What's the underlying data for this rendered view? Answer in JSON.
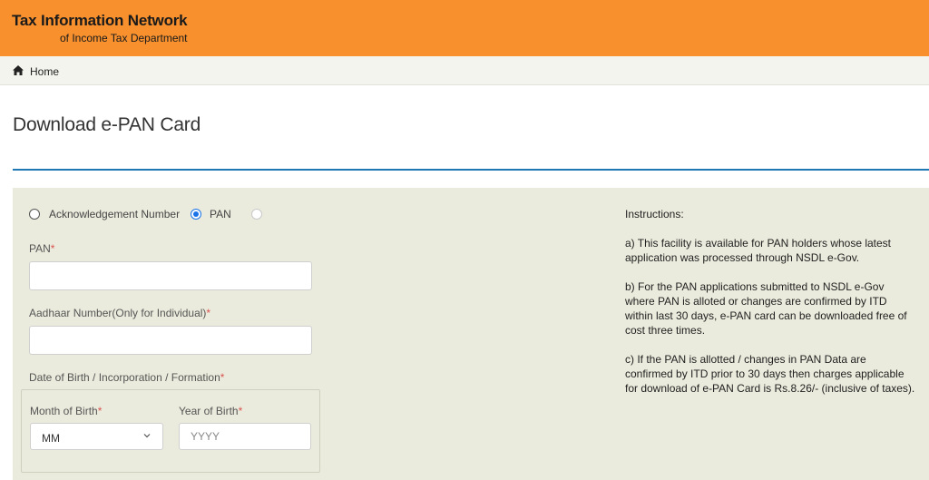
{
  "header": {
    "title": "Tax Information Network",
    "subtitle": "of Income Tax Department",
    "background_color": "#f7902d"
  },
  "breadcrumb": {
    "home_label": "Home",
    "home_icon": "home-icon"
  },
  "page": {
    "title": "Download e-PAN Card",
    "rule_color": "#1f78b4"
  },
  "form": {
    "radio_options": [
      {
        "label": "Acknowledgement Number",
        "checked": false
      },
      {
        "label": "PAN",
        "checked": true
      },
      {
        "label": "",
        "checked": false
      }
    ],
    "pan_label": "PAN",
    "pan_value": "",
    "aadhaar_label": "Aadhaar Number(Only for Individual)",
    "aadhaar_value": "",
    "dob_label": "Date of Birth / Incorporation / Formation",
    "month_label": "Month of Birth",
    "month_selected": "MM",
    "year_label": "Year of Birth",
    "year_placeholder": "YYYY",
    "required_marker": "*"
  },
  "instructions": {
    "heading": "Instructions:",
    "items": [
      "a) This facility is available for PAN holders whose latest application was processed through NSDL e-Gov.",
      "b) For the PAN applications submitted to NSDL e-Gov where PAN is alloted or changes are confirmed by ITD within last 30 days, e-PAN card can be downloaded free of cost three times.",
      "c) If the PAN is allotted / changes in PAN Data are confirmed by ITD prior to 30 days then charges applicable for download of e-PAN Card is Rs.8.26/- (inclusive of taxes)."
    ]
  }
}
